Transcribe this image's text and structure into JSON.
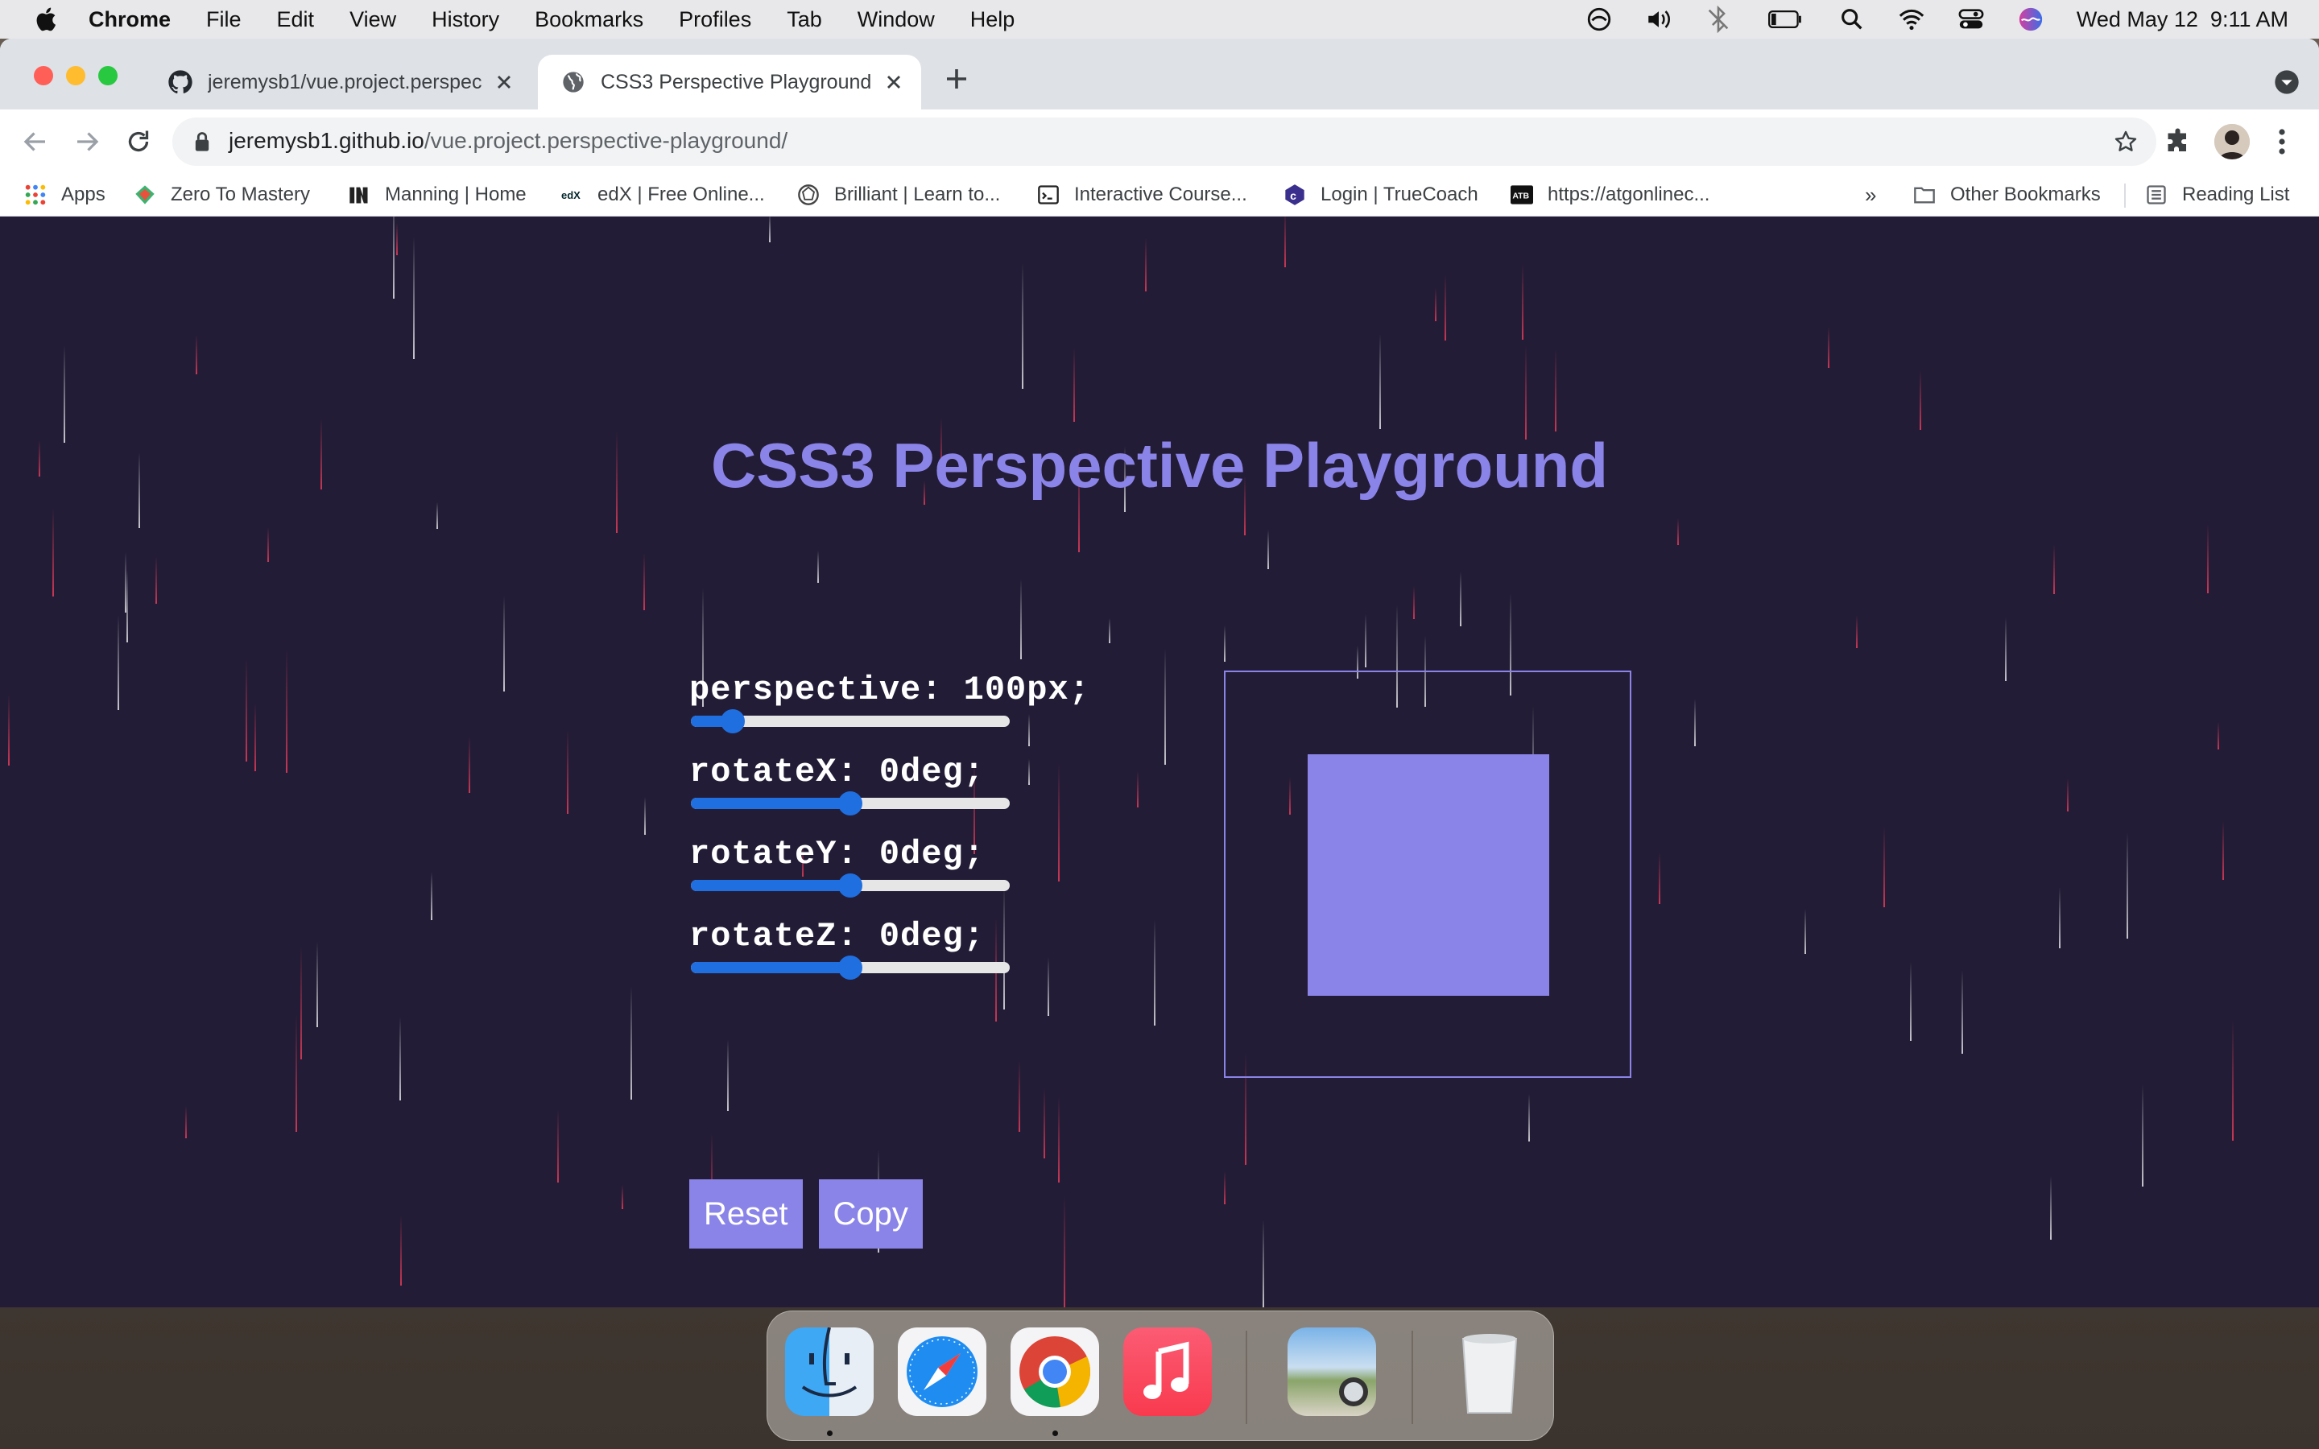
{
  "menubar": {
    "app_name": "Chrome",
    "menus": [
      "File",
      "Edit",
      "View",
      "History",
      "Bookmarks",
      "Profiles",
      "Tab",
      "Window",
      "Help"
    ],
    "datetime": "Wed May 12  9:11 AM"
  },
  "tabs": [
    {
      "title": "jeremysb1/vue.project.perspec",
      "favicon": "github-icon",
      "active": false
    },
    {
      "title": "CSS3 Perspective Playground",
      "favicon": "globe-icon",
      "active": true
    }
  ],
  "address_bar": {
    "host": "jeremysb1.github.io",
    "path": "/vue.project.perspective-playground/"
  },
  "bookmarks": [
    {
      "label": "Apps",
      "icon": "apps-grid-icon"
    },
    {
      "label": "Zero To Mastery",
      "icon": "ztm-icon"
    },
    {
      "label": "Manning | Home",
      "icon": "manning-icon"
    },
    {
      "label": "edX | Free Online...",
      "icon": "edx-icon"
    },
    {
      "label": "Brilliant | Learn to...",
      "icon": "brilliant-icon"
    },
    {
      "label": "Interactive Course...",
      "icon": "terminal-icon"
    },
    {
      "label": "Login | TrueCoach",
      "icon": "truecoach-icon"
    },
    {
      "label": "https://atgonlinec...",
      "icon": "atb-icon"
    }
  ],
  "bookmarks_overflow": "»",
  "other_bookmarks": "Other Bookmarks",
  "reading_list": "Reading List",
  "page": {
    "title": "CSS3 Perspective Playground",
    "controls": [
      {
        "label": "perspective: 100px;",
        "value": 100,
        "min": 0,
        "max": 1000
      },
      {
        "label": "rotateX: 0deg;",
        "value": 0,
        "min": -180,
        "max": 180
      },
      {
        "label": "rotateY: 0deg;",
        "value": 0,
        "min": -180,
        "max": 180
      },
      {
        "label": "rotateZ: 0deg;",
        "value": 0,
        "min": -180,
        "max": 180
      }
    ],
    "reset_label": "Reset",
    "copy_label": "Copy"
  },
  "colors": {
    "page_bg": "#231c36",
    "accent": "#8b84e8",
    "slider": "#1f6fe0"
  },
  "dock": [
    "finder-icon",
    "safari-icon",
    "chrome-icon",
    "music-icon",
    "preview-icon",
    "trash-icon"
  ]
}
